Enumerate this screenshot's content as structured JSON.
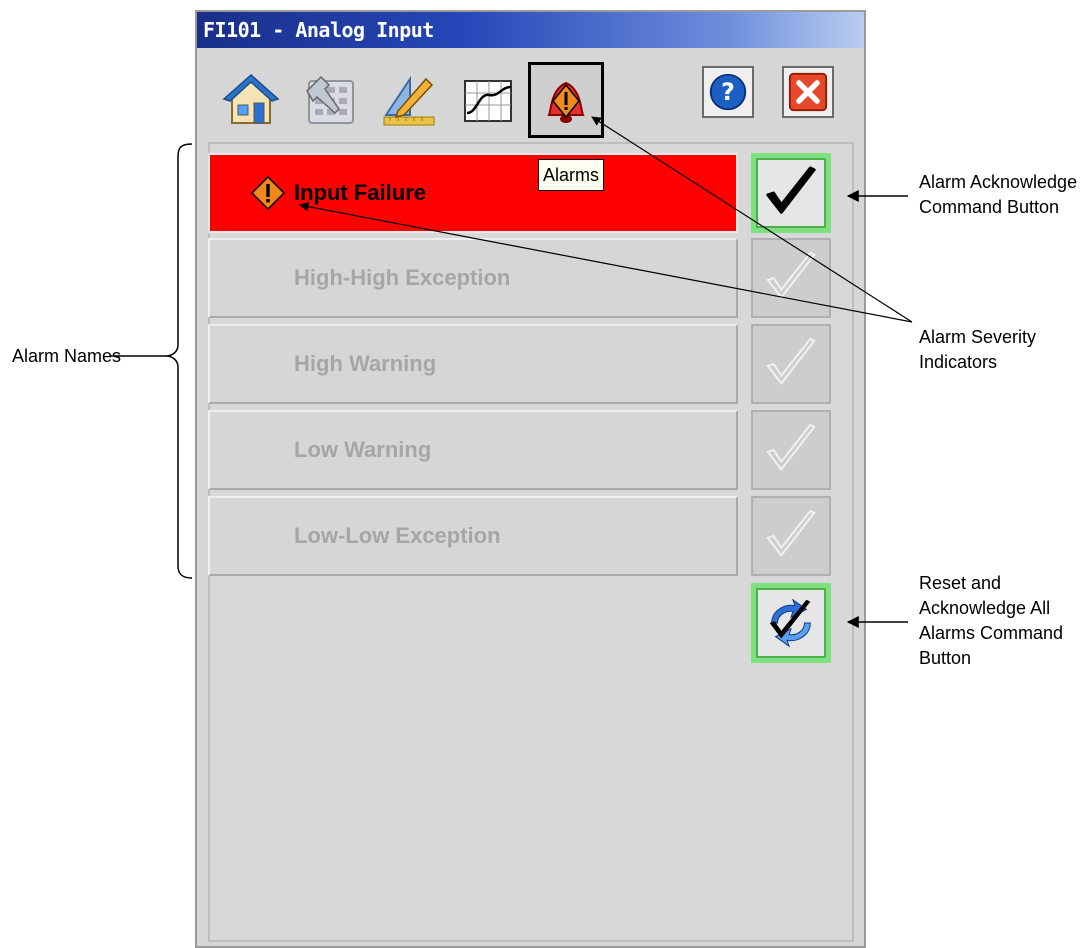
{
  "window": {
    "title": "FI101 - Analog Input"
  },
  "toolbar": {
    "tabs": [
      {
        "icon": "home-icon"
      },
      {
        "icon": "maintenance-icon"
      },
      {
        "icon": "engineering-icon"
      },
      {
        "icon": "trend-icon"
      },
      {
        "icon": "alarm-bell-icon",
        "tooltip": "Alarms"
      }
    ],
    "help_icon": "help-icon",
    "close_icon": "close-icon"
  },
  "alarms": [
    {
      "name": "Input Failure",
      "state": "active"
    },
    {
      "name": "High-High Exception",
      "state": "inactive"
    },
    {
      "name": "High Warning",
      "state": "inactive"
    },
    {
      "name": "Low Warning",
      "state": "inactive"
    },
    {
      "name": "Low-Low Exception",
      "state": "inactive"
    }
  ],
  "colors": {
    "active_alarm": "#ff0000",
    "ack_border": "#7fe07f",
    "severity": "#e86a10"
  },
  "annotations": {
    "alarm_names": "Alarm Names",
    "ack_button_line1": "Alarm Acknowledge",
    "ack_button_line2": "Command Button",
    "severity_line1": "Alarm Severity",
    "severity_line2": "Indicators",
    "reset_line1": "Reset and",
    "reset_line2": "Acknowledge All",
    "reset_line3": "Alarms Command",
    "reset_line4": "Button"
  }
}
